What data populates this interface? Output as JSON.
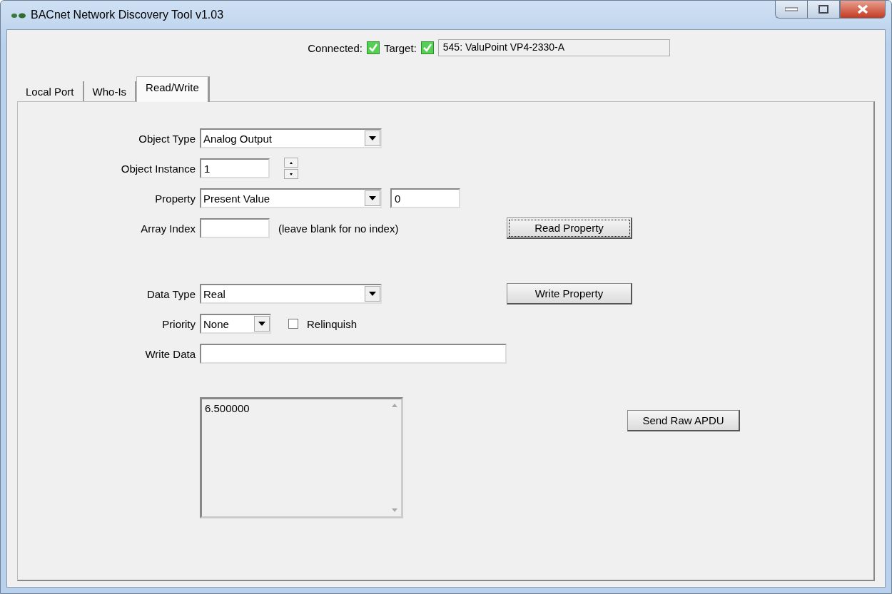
{
  "window": {
    "title": "BACnet Network Discovery Tool v1.03"
  },
  "status": {
    "connected_label": "Connected:",
    "connected": true,
    "target_label": "Target:",
    "target": true,
    "target_device": "545: ValuPoint VP4-2330-A"
  },
  "tabs": [
    {
      "label": "Local Port",
      "selected": false
    },
    {
      "label": "Who-Is",
      "selected": false
    },
    {
      "label": "Read/Write",
      "selected": true
    }
  ],
  "read_section": [
    {
      "kind": "dropdown",
      "label": "Object Type",
      "value": "Analog Output"
    },
    {
      "kind": "spinner",
      "label": "Object Instance",
      "value": "1"
    },
    {
      "kind": "dropdown",
      "label": "Property",
      "value": "Present Value",
      "extra_value": "0"
    },
    {
      "kind": "index",
      "label": "Array Index",
      "hint": "(leave blank for no index)",
      "button": "Read Property",
      "button_focused": true
    }
  ],
  "write_section": [
    {
      "kind": "dropdown",
      "label": "Data Type",
      "value": "Real",
      "button": "Write Property",
      "button_focused": false
    },
    {
      "kind": "priority",
      "label": "Priority",
      "value": "None",
      "checkbox_label": "Relinquish",
      "checked": false
    },
    {
      "kind": "data",
      "label": "Write Data"
    }
  ],
  "output": {
    "value": "6.500000",
    "button": "Send Raw APDU"
  }
}
